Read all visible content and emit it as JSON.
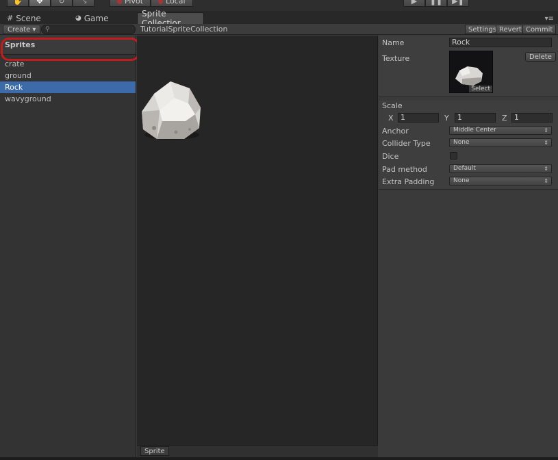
{
  "toolbar": {
    "pivot_label": "Pivot",
    "local_label": "Local"
  },
  "tabs": {
    "scene": "Scene",
    "game": "Game",
    "sprite_collection": "Sprite Collectior"
  },
  "header": {
    "create_label": "Create ▾",
    "collection_name": "TutorialSpriteCollection",
    "settings_label": "Settings",
    "revert_label": "Revert",
    "commit_label": "Commit"
  },
  "sprites_panel": {
    "title": "Sprites",
    "items": [
      {
        "label": "crate"
      },
      {
        "label": "ground"
      },
      {
        "label": "Rock"
      },
      {
        "label": "wavyground"
      }
    ],
    "selected_index": 2
  },
  "center": {
    "sprite_tab_label": "Sprite"
  },
  "inspector": {
    "name_label": "Name",
    "name_value": "Rock",
    "texture_label": "Texture",
    "delete_label": "Delete",
    "select_label": "Select",
    "scale_label": "Scale",
    "scale_x_label": "X",
    "scale_x_value": "1",
    "scale_y_label": "Y",
    "scale_y_value": "1",
    "scale_z_label": "Z",
    "scale_z_value": "1",
    "anchor_label": "Anchor",
    "anchor_value": "Middle Center",
    "collider_label": "Collider Type",
    "collider_value": "None",
    "dice_label": "Dice",
    "dice_checked": false,
    "pad_label": "Pad method",
    "pad_value": "Default",
    "extra_padding_label": "Extra Padding",
    "extra_padding_value": "None"
  },
  "colors": {
    "selection": "#3d6aa8",
    "highlight_ring": "#c41c1c"
  }
}
